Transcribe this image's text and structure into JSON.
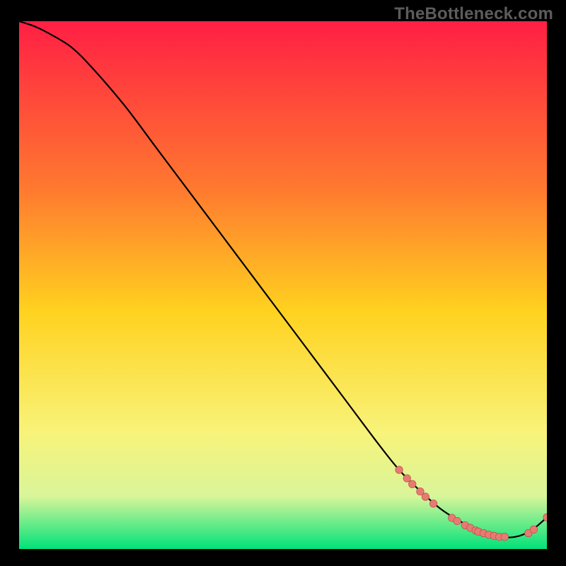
{
  "watermark": "TheBottleneck.com",
  "colors": {
    "gradient_top": "#ff1f44",
    "gradient_mid_upper": "#ff7a2f",
    "gradient_mid": "#ffd21f",
    "gradient_mid_lower": "#f8f37a",
    "gradient_low": "#d9f59a",
    "gradient_bottom": "#00e27a",
    "curve": "#000000",
    "marker": "#e77b72",
    "marker_stroke": "#b24a44",
    "background": "#000000"
  },
  "chart_data": {
    "type": "line",
    "title": "",
    "xlabel": "",
    "ylabel": "",
    "xlim": [
      0,
      100
    ],
    "ylim": [
      0,
      100
    ],
    "series": [
      {
        "name": "bottleneck-curve",
        "x": [
          0,
          3,
          6,
          10,
          14,
          20,
          26,
          32,
          38,
          44,
          50,
          56,
          62,
          68,
          72,
          76,
          80,
          84,
          88,
          91,
          94,
          97,
          100
        ],
        "y": [
          100,
          99,
          97.5,
          95,
          91,
          84,
          76,
          68,
          60,
          52,
          44,
          36,
          28,
          20,
          15,
          11,
          7.5,
          5,
          3,
          2.3,
          2.3,
          3.5,
          6
        ]
      }
    ],
    "markers": [
      {
        "x": 72.0,
        "y": 15.0
      },
      {
        "x": 73.5,
        "y": 13.4
      },
      {
        "x": 74.5,
        "y": 12.3
      },
      {
        "x": 76.0,
        "y": 10.9
      },
      {
        "x": 77.0,
        "y": 9.9
      },
      {
        "x": 78.5,
        "y": 8.6
      },
      {
        "x": 82.0,
        "y": 5.9
      },
      {
        "x": 83.0,
        "y": 5.3
      },
      {
        "x": 84.5,
        "y": 4.5
      },
      {
        "x": 85.5,
        "y": 4.0
      },
      {
        "x": 86.5,
        "y": 3.5
      },
      {
        "x": 87.0,
        "y": 3.3
      },
      {
        "x": 88.0,
        "y": 3.0
      },
      {
        "x": 89.0,
        "y": 2.7
      },
      {
        "x": 90.0,
        "y": 2.5
      },
      {
        "x": 91.0,
        "y": 2.3
      },
      {
        "x": 92.0,
        "y": 2.3
      },
      {
        "x": 96.5,
        "y": 3.0
      },
      {
        "x": 97.5,
        "y": 3.7
      },
      {
        "x": 100.0,
        "y": 6.0
      }
    ]
  }
}
